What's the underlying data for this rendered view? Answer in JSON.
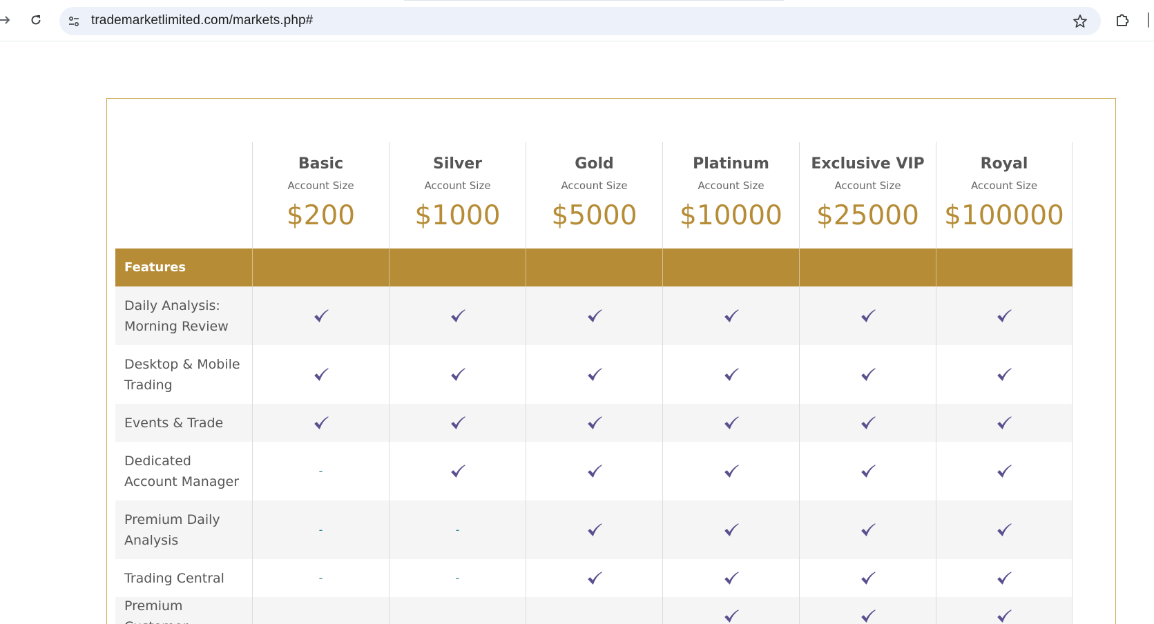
{
  "browser": {
    "url": "trademarketlimited.com/markets.php#"
  },
  "icons": {
    "forward": "arrow-right-icon",
    "reload": "reload-icon",
    "site_info": "tune-icon",
    "bookmark": "star-icon",
    "extensions": "puzzle-icon",
    "check": "check-icon"
  },
  "colors": {
    "gold": "#b68c36",
    "check": "#5b4f8f",
    "dash": "#2c8a92"
  },
  "table": {
    "features_label": "Features",
    "account_size_label": "Account Size",
    "plans": [
      {
        "name": "Basic",
        "price": "$200"
      },
      {
        "name": "Silver",
        "price": "$1000"
      },
      {
        "name": "Gold",
        "price": "$5000"
      },
      {
        "name": "Platinum",
        "price": "$10000"
      },
      {
        "name": "Exclusive VIP",
        "price": "$25000"
      },
      {
        "name": "Royal",
        "price": "$100000"
      }
    ],
    "rows": [
      {
        "feature": "Daily Analysis: Morning Review",
        "values": [
          "check",
          "check",
          "check",
          "check",
          "check",
          "check"
        ]
      },
      {
        "feature": "Desktop & Mobile Trading",
        "values": [
          "check",
          "check",
          "check",
          "check",
          "check",
          "check"
        ]
      },
      {
        "feature": "Events & Trade",
        "values": [
          "check",
          "check",
          "check",
          "check",
          "check",
          "check"
        ]
      },
      {
        "feature": "Dedicated Account Manager",
        "values": [
          "-",
          "check",
          "check",
          "check",
          "check",
          "check"
        ]
      },
      {
        "feature": "Premium Daily Analysis",
        "values": [
          "-",
          "-",
          "check",
          "check",
          "check",
          "check"
        ]
      },
      {
        "feature": "Trading Central",
        "values": [
          "-",
          "-",
          "check",
          "check",
          "check",
          "check"
        ]
      },
      {
        "feature": "Premium Customer",
        "values": [
          "",
          "",
          "",
          "check",
          "check",
          "check"
        ]
      }
    ]
  }
}
